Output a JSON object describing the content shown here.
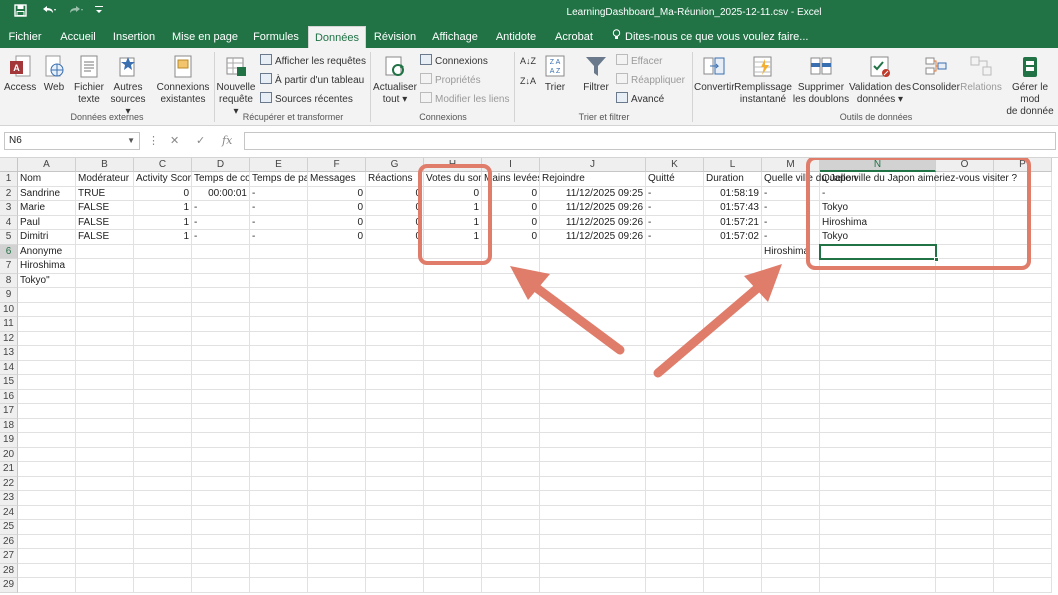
{
  "window": {
    "title": "LearningDashboard_Ma-Réunion_2025-12-11.csv - Excel",
    "qa_icons": [
      "save-icon",
      "undo-icon",
      "redo-icon",
      "customize-icon"
    ]
  },
  "tabs": [
    {
      "label": "Fichier"
    },
    {
      "label": "Accueil"
    },
    {
      "label": "Insertion"
    },
    {
      "label": "Mise en page"
    },
    {
      "label": "Formules"
    },
    {
      "label": "Données"
    },
    {
      "label": "Révision"
    },
    {
      "label": "Affichage"
    },
    {
      "label": "Antidote"
    },
    {
      "label": "Acrobat"
    }
  ],
  "active_tab": "Données",
  "tell_me": "Dites-nous ce que vous voulez faire...",
  "ribbon": {
    "ext": {
      "access": "Access",
      "web": "Web",
      "fichier_l1": "Fichier",
      "fichier_l2": "texte",
      "autres_l1": "Autres",
      "autres_l2": "sources ▾",
      "conn_l1": "Connexions",
      "conn_l2": "existantes",
      "group": "Données externes"
    },
    "transform": {
      "nouvelle_l1": "Nouvelle",
      "nouvelle_l2": "requête ▾",
      "afficher": "Afficher les requêtes",
      "partir": "À partir d'un tableau",
      "sources": "Sources récentes",
      "group": "Récupérer et transformer"
    },
    "connexions": {
      "actualiser_l1": "Actualiser",
      "actualiser_l2": "tout ▾",
      "connexions": "Connexions",
      "proprietes": "Propriétés",
      "modifier": "Modifier les liens",
      "group": "Connexions"
    },
    "sort": {
      "az": "A↓Z",
      "za": "Z↓A",
      "trier": "Trier",
      "filtrer": "Filtrer",
      "effacer": "Effacer",
      "reappliquer": "Réappliquer",
      "avance": "Avancé",
      "group": "Trier et filtrer"
    },
    "tools": {
      "convertir": "Convertir",
      "remp_l1": "Remplissage",
      "remp_l2": "instantané",
      "supp_l1": "Supprimer",
      "supp_l2": "les doublons",
      "valid_l1": "Validation des",
      "valid_l2": "données ▾",
      "consolider": "Consolider",
      "relations": "Relations",
      "gerer_l1": "Gérer le mod",
      "gerer_l2": "de donnée",
      "group": "Outils de données"
    }
  },
  "namebox": "N6",
  "formula": "",
  "columns": [
    "A",
    "B",
    "C",
    "D",
    "E",
    "F",
    "G",
    "H",
    "I",
    "J",
    "K",
    "L",
    "M",
    "N",
    "O",
    "P"
  ],
  "selected_column": "N",
  "rows": [
    {
      "n": "1",
      "A": "Nom",
      "B": "Modérateur",
      "C": "Activity Score",
      "D": "Temps de connexion",
      "E": "Temps de parole",
      "F": "Messages",
      "G": "Réactions",
      "H": "Votes du sondage",
      "I": "Mains levées",
      "J": "Rejoindre",
      "K": "Quitté",
      "L": "Duration",
      "M": "Quelle ville du Japon",
      "N": "Quelle ville du Japon aimeriez-vous visiter ?",
      "O": "",
      "P": ""
    },
    {
      "n": "2",
      "A": "Sandrine",
      "B": "TRUE",
      "C": "0",
      "D": "00:00:01",
      "E": "-",
      "F": "0",
      "G": "0",
      "H": "0",
      "I": "0",
      "J": "11/12/2025 09:25",
      "K": "-",
      "L": "01:58:19",
      "M": "-",
      "N": "-",
      "O": "",
      "P": ""
    },
    {
      "n": "3",
      "A": "Marie",
      "B": "FALSE",
      "C": "1",
      "D": "-",
      "E": "-",
      "F": "0",
      "G": "0",
      "H": "1",
      "I": "0",
      "J": "11/12/2025 09:26",
      "K": "-",
      "L": "01:57:43",
      "M": "-",
      "N": "Tokyo",
      "O": "",
      "P": ""
    },
    {
      "n": "4",
      "A": "Paul",
      "B": "FALSE",
      "C": "1",
      "D": "-",
      "E": "-",
      "F": "0",
      "G": "0",
      "H": "1",
      "I": "0",
      "J": "11/12/2025 09:26",
      "K": "-",
      "L": "01:57:21",
      "M": "-",
      "N": "Hiroshima",
      "O": "",
      "P": ""
    },
    {
      "n": "5",
      "A": "Dimitri",
      "B": "FALSE",
      "C": "1",
      "D": "-",
      "E": "-",
      "F": "0",
      "G": "0",
      "H": "1",
      "I": "0",
      "J": "11/12/2025 09:26",
      "K": "-",
      "L": "01:57:02",
      "M": "-",
      "N": "Tokyo",
      "O": "",
      "P": ""
    },
    {
      "n": "6",
      "A": "Anonyme",
      "M": "Hiroshima"
    },
    {
      "n": "7",
      "A": "Hiroshima"
    },
    {
      "n": "8",
      "A": "Tokyo\""
    },
    {
      "n": "9"
    },
    {
      "n": "10"
    },
    {
      "n": "11"
    },
    {
      "n": "12"
    },
    {
      "n": "13"
    },
    {
      "n": "14"
    },
    {
      "n": "15"
    },
    {
      "n": "16"
    },
    {
      "n": "17"
    },
    {
      "n": "18"
    },
    {
      "n": "19"
    },
    {
      "n": "20"
    },
    {
      "n": "21"
    },
    {
      "n": "22"
    },
    {
      "n": "23"
    },
    {
      "n": "24"
    },
    {
      "n": "25"
    },
    {
      "n": "26"
    },
    {
      "n": "27"
    },
    {
      "n": "28"
    },
    {
      "n": "29"
    }
  ],
  "active_cell": "N6",
  "annotation_color": "#e07c6a",
  "accent_color": "#217346"
}
